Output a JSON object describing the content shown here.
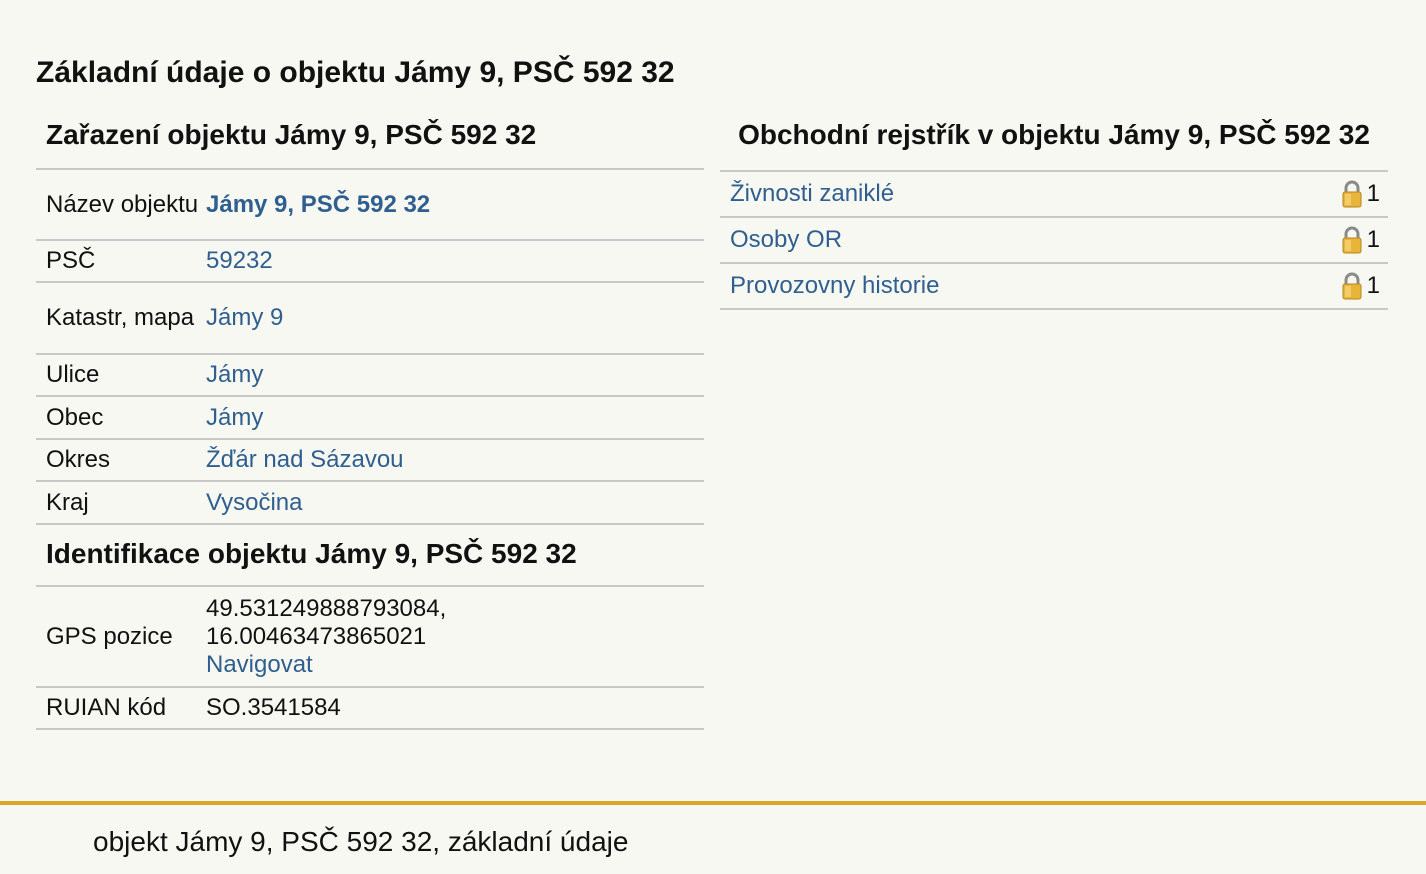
{
  "page_title": "Základní údaje o objektu Jámy 9, PSČ 592 32",
  "zarazeni": {
    "title": "Zařazení objektu Jámy 9, PSČ 592 32",
    "rows": [
      {
        "label": "Název objektu",
        "value": "Jámy 9, PSČ 592 32"
      },
      {
        "label": "PSČ",
        "value": "59232"
      },
      {
        "label": "Katastr, mapa",
        "value": "Jámy 9"
      },
      {
        "label": "Ulice",
        "value": "Jámy"
      },
      {
        "label": "Obec",
        "value": "Jámy"
      },
      {
        "label": "Okres",
        "value": "Žďár nad Sázavou"
      },
      {
        "label": "Kraj",
        "value": "Vysočina"
      }
    ]
  },
  "identifikace": {
    "title": "Identifikace objektu Jámy 9, PSČ 592 32",
    "gps_label": "GPS pozice",
    "gps_lat": "49.531249888793084,",
    "gps_lon": "16.00463473865021",
    "navigate_label": "Navigovat",
    "ruian_label": "RUIAN kód",
    "ruian_value": "SO.3541584"
  },
  "obchodni_rejstrik": {
    "title": "Obchodní rejstřík v objektu Jámy 9, PSČ 592 32",
    "items": [
      {
        "label": "Živnosti zaniklé",
        "count": "1",
        "icon": "lock-icon"
      },
      {
        "label": "Osoby OR",
        "count": "1",
        "icon": "lock-icon"
      },
      {
        "label": "Provozovny historie",
        "count": "1",
        "icon": "lock-icon"
      }
    ]
  },
  "footer": {
    "text": "objekt Jámy 9, PSČ 592 32, základní údaje"
  },
  "colors": {
    "link": "#2f5f8f",
    "footer_accent": "#d9a62e",
    "background": "#f8f8f3"
  }
}
